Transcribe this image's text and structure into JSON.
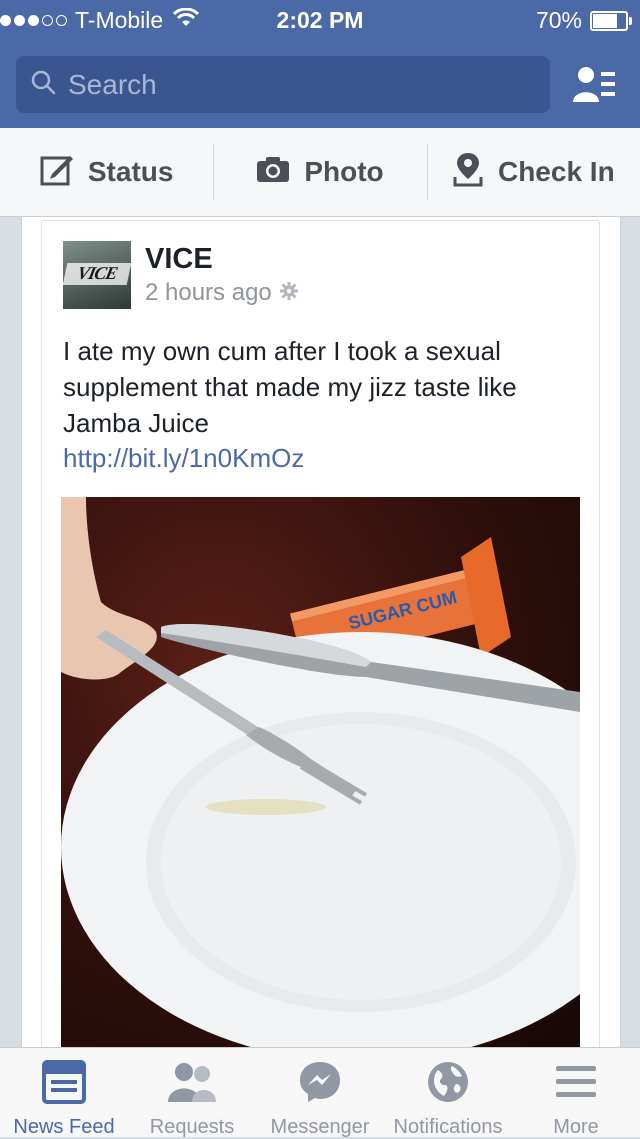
{
  "status_bar": {
    "carrier": "T-Mobile",
    "time": "2:02 PM",
    "battery": "70%",
    "battery_level": 0.7,
    "signal_bars": 3
  },
  "header": {
    "search_placeholder": "Search",
    "friends_icon": "friends-list-icon"
  },
  "composer": {
    "status_label": "Status",
    "photo_label": "Photo",
    "checkin_label": "Check In"
  },
  "post": {
    "author": "VICE",
    "avatar_text": "VICE",
    "time": "2 hours ago",
    "text": "I ate my own cum after I took a sexual supplement that made my jizz taste like Jamba Juice",
    "link": "http://bit.ly/1n0KmOz",
    "photo_packet_text": "SUGAR CUM"
  },
  "tabbar": {
    "tabs": [
      {
        "label": "News Feed",
        "icon": "news-feed-icon",
        "active": true
      },
      {
        "label": "Requests",
        "icon": "requests-icon",
        "active": false
      },
      {
        "label": "Messenger",
        "icon": "messenger-icon",
        "active": false
      },
      {
        "label": "Notifications",
        "icon": "globe-icon",
        "active": false
      },
      {
        "label": "More",
        "icon": "menu-icon",
        "active": false
      }
    ]
  },
  "colors": {
    "brand_blue": "#4b69a6",
    "search_bg": "#3b5590",
    "link_blue": "#4b69a6"
  }
}
